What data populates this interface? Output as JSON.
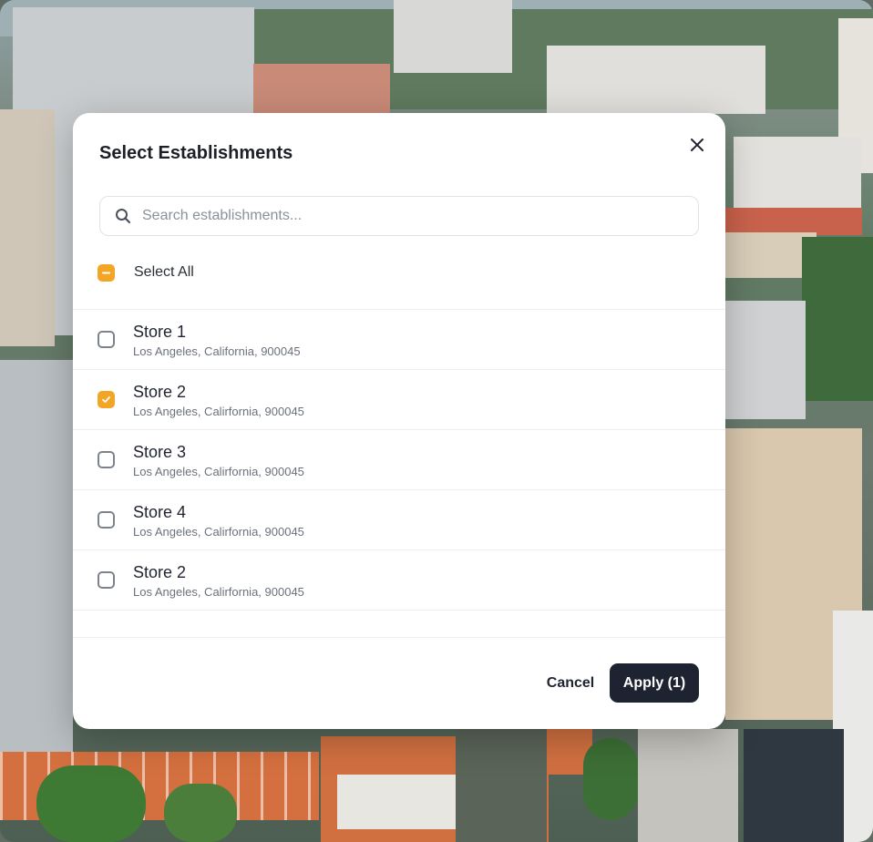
{
  "modal": {
    "title": "Select Establishments",
    "close_icon": "close-icon"
  },
  "search": {
    "placeholder": "Search establishments...",
    "value": "",
    "icon": "search-icon"
  },
  "select_all": {
    "label": "Select All",
    "state": "indeterminate"
  },
  "establishments": [
    {
      "name": "Store 1",
      "address": "Los Angeles, California, 900045",
      "checked": false
    },
    {
      "name": "Store 2",
      "address": "Los Angeles, Calirfornia, 900045",
      "checked": true
    },
    {
      "name": "Store 3",
      "address": "Los Angeles, Calirfornia, 900045",
      "checked": false
    },
    {
      "name": "Store 4",
      "address": "Los Angeles, Calirfornia, 900045",
      "checked": false
    },
    {
      "name": "Store 2",
      "address": "Los Angeles, Calirfornia, 900045",
      "checked": false
    }
  ],
  "footer": {
    "cancel_label": "Cancel",
    "apply_label": "Apply (1)"
  },
  "colors": {
    "accent": "#f3a525",
    "primary_button": "#1d2330",
    "text": "#1f2430"
  }
}
